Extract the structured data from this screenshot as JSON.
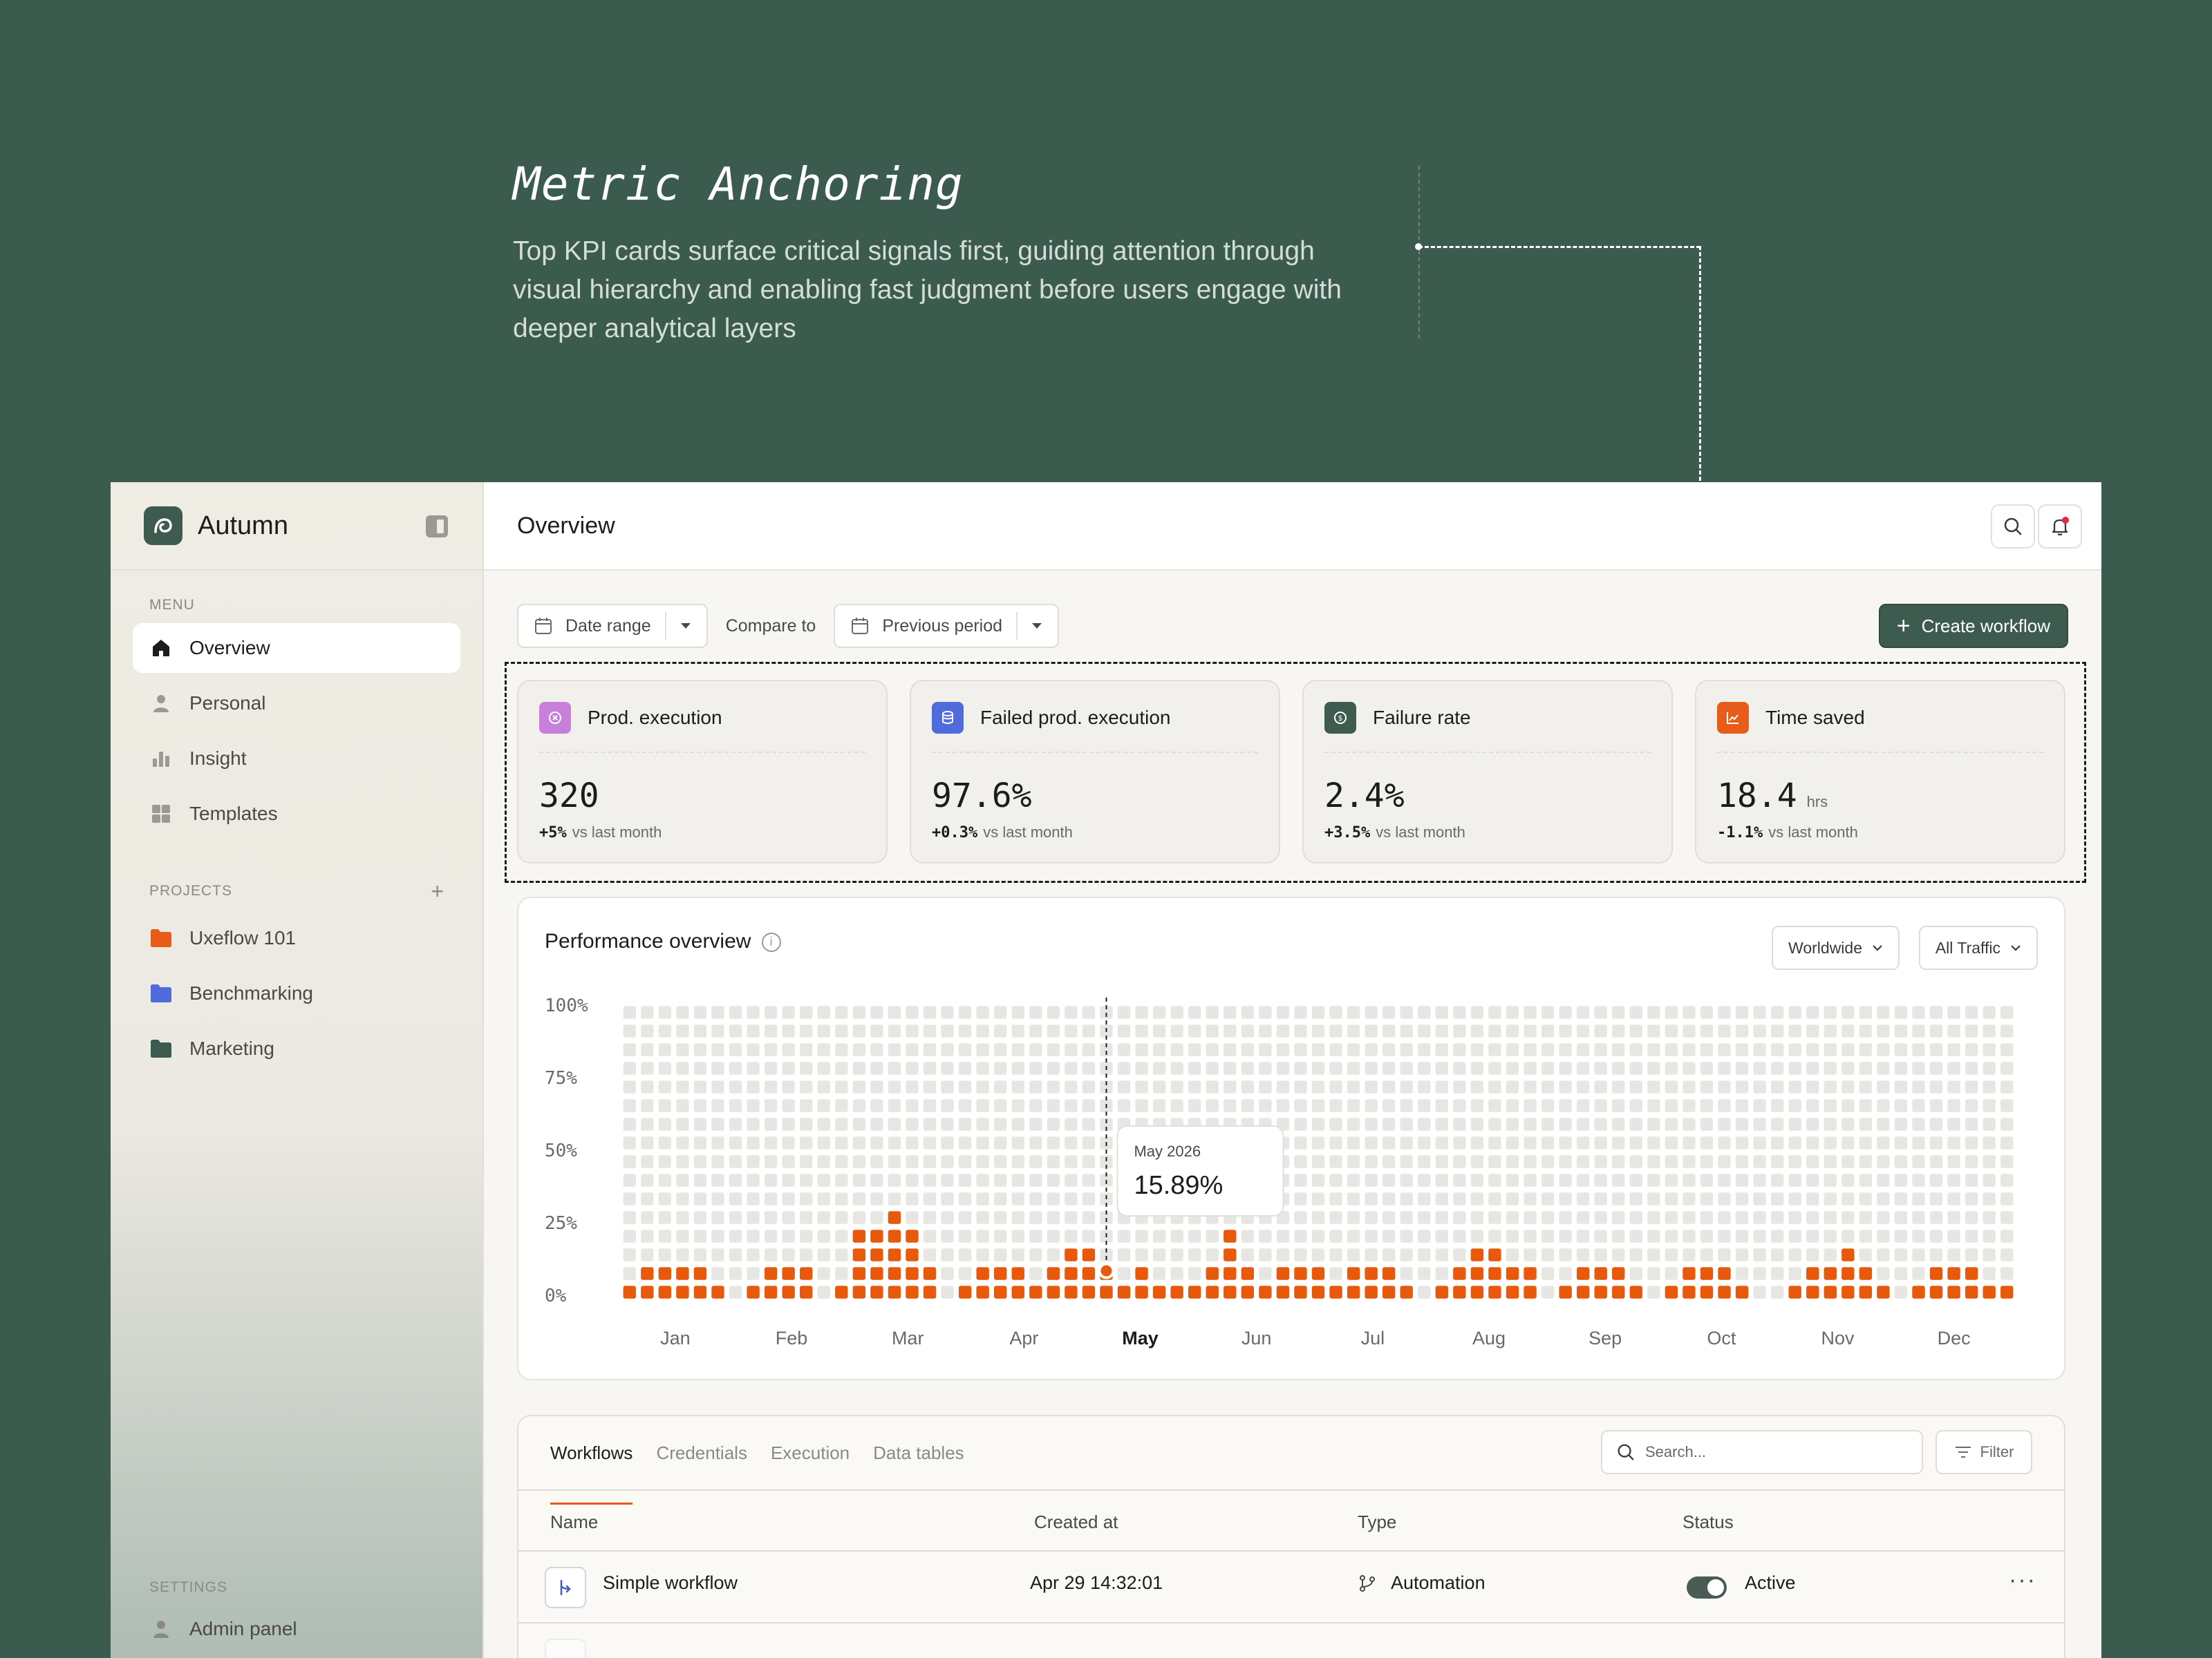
{
  "annotation": {
    "title": "Metric Anchoring",
    "description": "Top KPI cards surface critical signals first, guiding attention through visual hierarchy and enabling fast judgment before users engage with deeper analytical layers"
  },
  "brand": {
    "name": "Autumn",
    "accent": "#3d5c4f"
  },
  "sidebar": {
    "menu_label": "MENU",
    "items": [
      {
        "label": "Overview",
        "icon": "home-icon",
        "active": true
      },
      {
        "label": "Personal",
        "icon": "user-icon"
      },
      {
        "label": "Insight",
        "icon": "bar-chart-icon"
      },
      {
        "label": "Templates",
        "icon": "grid-icon"
      }
    ],
    "projects_label": "PROJECTS",
    "projects": [
      {
        "label": "Uxeflow 101",
        "color": "#e85c1a"
      },
      {
        "label": "Benchmarking",
        "color": "#4f6bdc"
      },
      {
        "label": "Marketing",
        "color": "#3d5c4f"
      }
    ],
    "settings_label": "SETTINGS",
    "settings_items": [
      {
        "label": "Admin panel"
      }
    ]
  },
  "header": {
    "title": "Overview"
  },
  "filters": {
    "date_range": "Date range",
    "compare_label": "Compare to",
    "compare_value": "Previous period",
    "create_button": "Create workflow"
  },
  "kpis": [
    {
      "label": "Prod. execution",
      "value": "320",
      "unit": "",
      "delta": "+5%",
      "delta_text": "vs last month",
      "icon_color": "#c77fd9"
    },
    {
      "label": "Failed prod. execution",
      "value": "97.6%",
      "unit": "",
      "delta": "+0.3%",
      "delta_text": "vs last month",
      "icon_color": "#4f6bdc"
    },
    {
      "label": "Failure rate",
      "value": "2.4%",
      "unit": "",
      "delta": "+3.5%",
      "delta_text": "vs last month",
      "icon_color": "#3d5c4f"
    },
    {
      "label": "Time saved",
      "value": "18.4",
      "unit": "hrs",
      "delta": "-1.1%",
      "delta_text": "vs last month",
      "icon_color": "#e85c1a"
    }
  ],
  "performance": {
    "title": "Performance overview",
    "region": "Worldwide",
    "traffic": "All Traffic"
  },
  "chart_data": {
    "type": "bar",
    "title": "Performance overview",
    "y_ticks": [
      "100%",
      "75%",
      "50%",
      "25%",
      "0%"
    ],
    "ylim": [
      0,
      100
    ],
    "months": [
      "Jan",
      "Feb",
      "Mar",
      "Apr",
      "May",
      "Jun",
      "Jul",
      "Aug",
      "Sep",
      "Oct",
      "Nov",
      "Dec"
    ],
    "highlight_month": "May",
    "tooltip": {
      "label": "May 2026",
      "value": "15.89%"
    },
    "highlight_index": 27,
    "color_active": "#e8590c",
    "color_track": "#e7e6e2",
    "values": [
      7,
      10,
      14,
      14,
      10,
      7,
      3,
      5,
      10,
      14,
      10,
      3,
      7,
      24,
      27,
      31,
      24,
      14,
      3,
      7,
      10,
      14,
      10,
      7,
      10,
      17,
      17,
      14,
      7,
      10,
      7,
      7,
      7,
      10,
      24,
      14,
      7,
      10,
      10,
      10,
      7,
      14,
      14,
      10,
      7,
      3,
      7,
      10,
      17,
      17,
      14,
      10,
      3,
      7,
      14,
      14,
      10,
      7,
      3,
      7,
      10,
      14,
      10,
      7,
      3,
      3,
      7,
      10,
      14,
      17,
      10,
      7,
      3,
      7,
      10,
      14,
      10,
      7,
      7
    ]
  },
  "table": {
    "tabs": [
      "Workflows",
      "Credentials",
      "Execution",
      "Data tables"
    ],
    "search_placeholder": "Search...",
    "filter_label": "Filter",
    "columns": [
      "Name",
      "Created at",
      "Type",
      "Status"
    ],
    "rows": [
      {
        "name": "Simple workflow",
        "created": "Apr 29 14:32:01",
        "type": "Automation",
        "status": "Active"
      }
    ]
  }
}
